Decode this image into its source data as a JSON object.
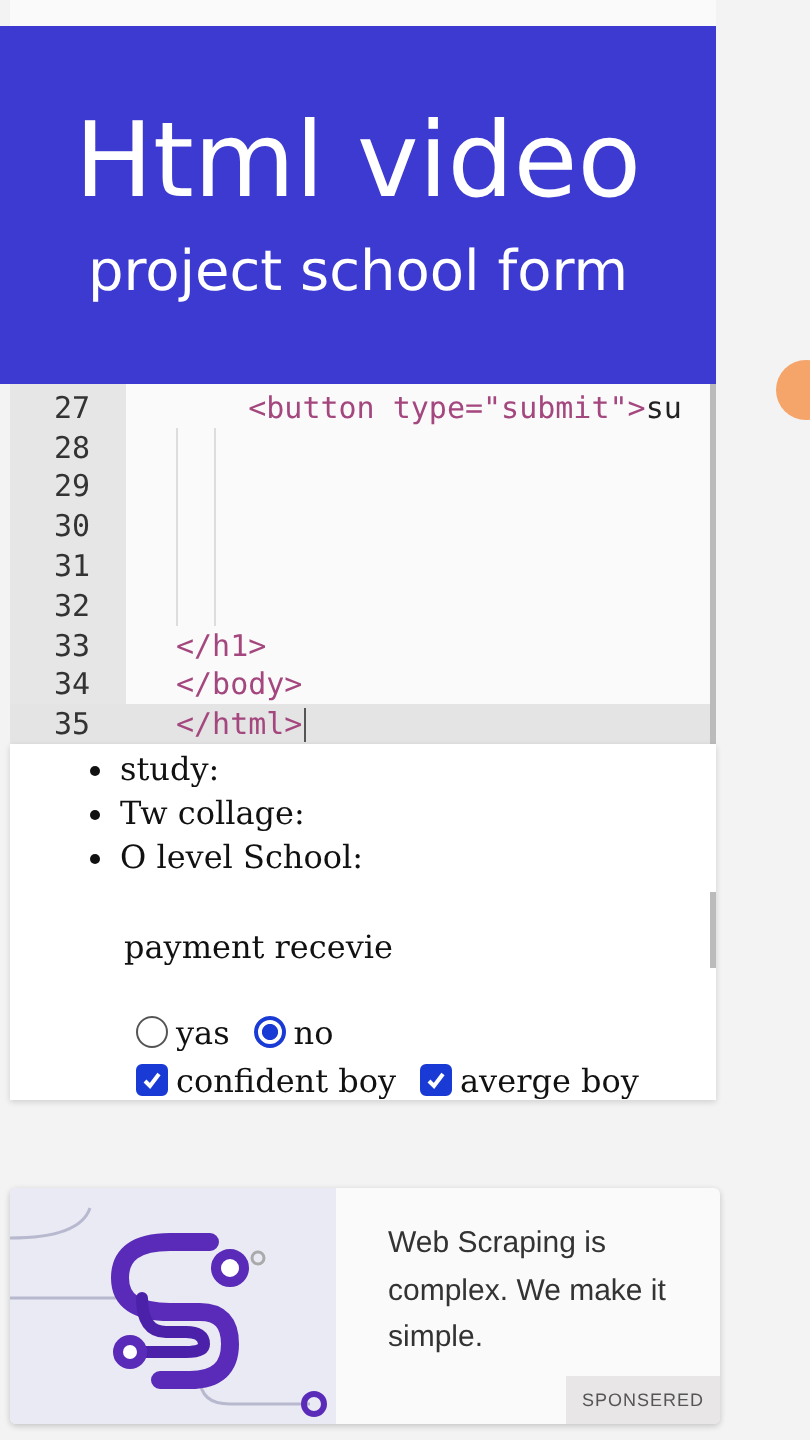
{
  "video_caption": {
    "title": "Html video",
    "subtitle": "project school form"
  },
  "editor": {
    "lines": [
      {
        "number": "27",
        "current": false,
        "segments": [
          {
            "text": "    <button type=\"submit\">",
            "kind": "tag"
          },
          {
            "text": "su",
            "kind": "plain"
          }
        ]
      },
      {
        "number": "28",
        "current": false
      },
      {
        "number": "29",
        "current": false
      },
      {
        "number": "30",
        "current": false
      },
      {
        "number": "31",
        "current": false
      },
      {
        "number": "32",
        "current": false
      },
      {
        "number": "33",
        "current": false,
        "segments": [
          {
            "text": "</h1>",
            "kind": "tag"
          }
        ]
      },
      {
        "number": "34",
        "current": false,
        "segments": [
          {
            "text": "</body>",
            "kind": "tag"
          }
        ]
      },
      {
        "number": "35",
        "current": true,
        "segments": [
          {
            "text": "</html>",
            "kind": "tag"
          }
        ]
      }
    ]
  },
  "preview": {
    "list": [
      "study:",
      "Tw collage:",
      "O level School:"
    ],
    "paragraph": "payment recevie",
    "radios": [
      {
        "label": "yas",
        "selected": false
      },
      {
        "label": "no",
        "selected": true
      }
    ],
    "checkboxes": [
      {
        "label": "confident boy",
        "checked": true
      },
      {
        "label": "averge boy",
        "checked": true
      }
    ]
  },
  "ad": {
    "text": "Web Scraping is complex. We make it simple.",
    "badge": "SPONSERED"
  }
}
